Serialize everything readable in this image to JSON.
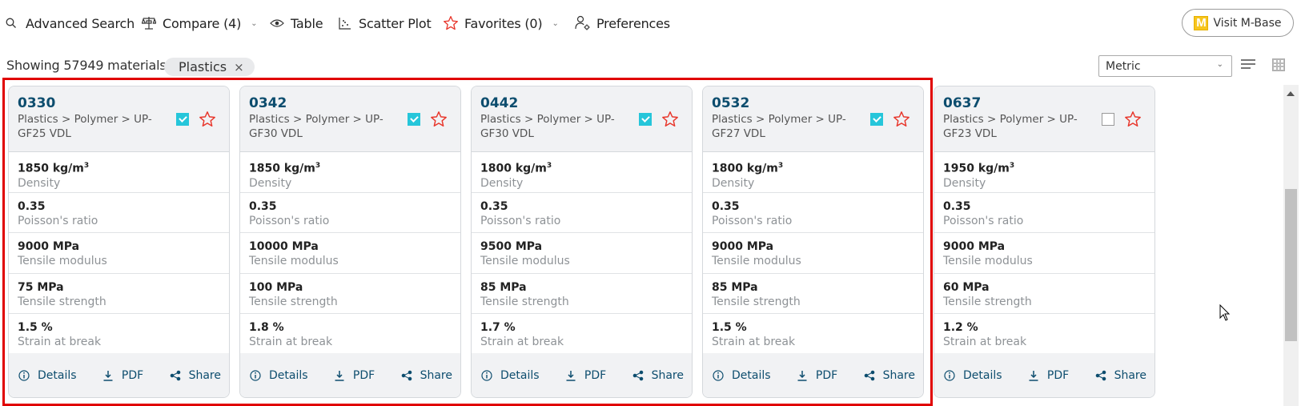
{
  "toolbar": {
    "advanced_search": "Advanced Search",
    "compare": "Compare (4)",
    "table": "Table",
    "scatter_plot": "Scatter Plot",
    "favorites": "Favorites (0)",
    "preferences": "Preferences",
    "visit_mbase": "Visit M-Base",
    "mbase_logo_letter": "M"
  },
  "results": {
    "showing": "Showing 57949 materials",
    "filter_chip": "Plastics",
    "filter_chip_remove": "×"
  },
  "view_controls": {
    "units_selected": "Metric"
  },
  "colors": {
    "accent": "#0d4d6e",
    "checkbox_checked": "#26c6da",
    "favorite_star": "#e8372c",
    "highlight_border": "#e00000"
  },
  "actions": {
    "details": "Details",
    "pdf": "PDF",
    "share": "Share"
  },
  "cards": [
    {
      "id": "0330",
      "path": "Plastics > Polymer > UP-GF25 VDL",
      "compared": true,
      "favorite": false,
      "props": [
        {
          "value": "1850 kg/m",
          "sup": "3",
          "label": "Density"
        },
        {
          "value": "0.35",
          "sup": "",
          "label": "Poisson's ratio"
        },
        {
          "value": "9000 MPa",
          "sup": "",
          "label": "Tensile modulus"
        },
        {
          "value": "75 MPa",
          "sup": "",
          "label": "Tensile strength"
        },
        {
          "value": "1.5 %",
          "sup": "",
          "label": "Strain at break"
        }
      ]
    },
    {
      "id": "0342",
      "path": "Plastics > Polymer > UP-GF30 VDL",
      "compared": true,
      "favorite": false,
      "props": [
        {
          "value": "1850 kg/m",
          "sup": "3",
          "label": "Density"
        },
        {
          "value": "0.35",
          "sup": "",
          "label": "Poisson's ratio"
        },
        {
          "value": "10000 MPa",
          "sup": "",
          "label": "Tensile modulus"
        },
        {
          "value": "100 MPa",
          "sup": "",
          "label": "Tensile strength"
        },
        {
          "value": "1.8 %",
          "sup": "",
          "label": "Strain at break"
        }
      ]
    },
    {
      "id": "0442",
      "path": "Plastics > Polymer > UP-GF30 VDL",
      "compared": true,
      "favorite": false,
      "props": [
        {
          "value": "1800 kg/m",
          "sup": "3",
          "label": "Density"
        },
        {
          "value": "0.35",
          "sup": "",
          "label": "Poisson's ratio"
        },
        {
          "value": "9500 MPa",
          "sup": "",
          "label": "Tensile modulus"
        },
        {
          "value": "85 MPa",
          "sup": "",
          "label": "Tensile strength"
        },
        {
          "value": "1.7 %",
          "sup": "",
          "label": "Strain at break"
        }
      ]
    },
    {
      "id": "0532",
      "path": "Plastics > Polymer > UP-GF27 VDL",
      "compared": true,
      "favorite": false,
      "props": [
        {
          "value": "1800 kg/m",
          "sup": "3",
          "label": "Density"
        },
        {
          "value": "0.35",
          "sup": "",
          "label": "Poisson's ratio"
        },
        {
          "value": "9000 MPa",
          "sup": "",
          "label": "Tensile modulus"
        },
        {
          "value": "85 MPa",
          "sup": "",
          "label": "Tensile strength"
        },
        {
          "value": "1.5 %",
          "sup": "",
          "label": "Strain at break"
        }
      ]
    },
    {
      "id": "0637",
      "path": "Plastics > Polymer > UP-GF23 VDL",
      "compared": false,
      "favorite": false,
      "props": [
        {
          "value": "1950 kg/m",
          "sup": "3",
          "label": "Density"
        },
        {
          "value": "0.35",
          "sup": "",
          "label": "Poisson's ratio"
        },
        {
          "value": "9000 MPa",
          "sup": "",
          "label": "Tensile modulus"
        },
        {
          "value": "60 MPa",
          "sup": "",
          "label": "Tensile strength"
        },
        {
          "value": "1.2 %",
          "sup": "",
          "label": "Strain at break"
        }
      ]
    }
  ]
}
